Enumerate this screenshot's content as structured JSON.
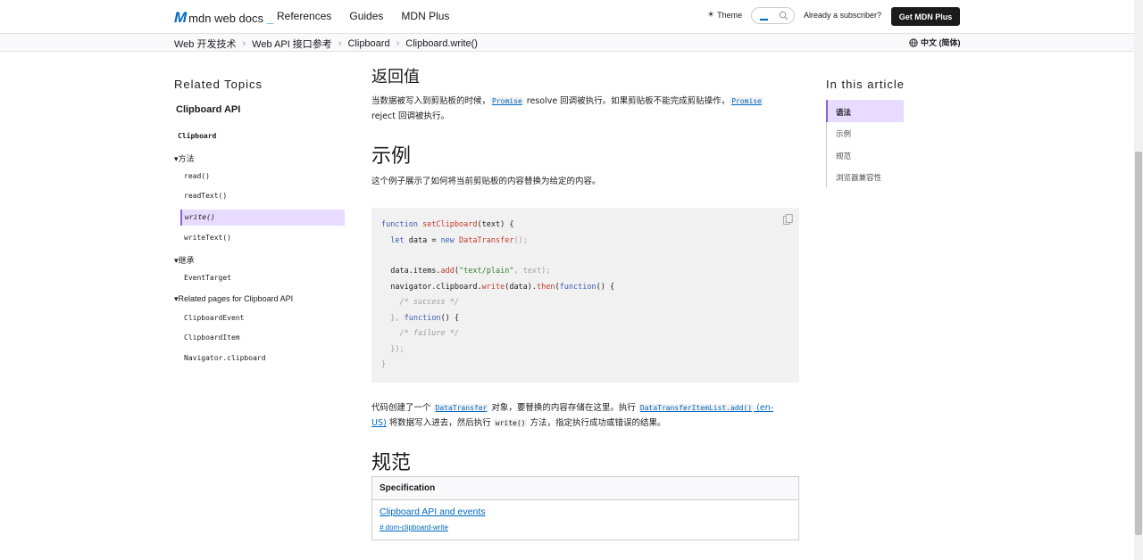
{
  "header": {
    "logo_mark": "M",
    "logo_text": "mdn web docs",
    "logo_underscore": "_",
    "nav": [
      "References",
      "Guides",
      "MDN Plus"
    ],
    "theme_label": "Theme",
    "subscriber_text": "Already a subscriber?",
    "cta_label": "Get MDN Plus"
  },
  "breadcrumb": {
    "items": [
      "Web 开发技术",
      "Web API 接口参考",
      "Clipboard",
      "Clipboard.write()"
    ],
    "language": "中文 (简体)"
  },
  "sidebar": {
    "related_title": "Related Topics",
    "api_title": "Clipboard API",
    "interface": "Clipboard",
    "methods_label": "方法",
    "methods": [
      "read()",
      "readText()",
      "write()",
      "writeText()"
    ],
    "inherit_label": "继承",
    "inherit_items": [
      "EventTarget"
    ],
    "related_label": "Related pages for Clipboard API",
    "related_items": [
      "ClipboardEvent",
      "ClipboardItem",
      "Navigator.clipboard"
    ]
  },
  "content": {
    "return_heading": "返回值",
    "return_p1": "当数据被写入到剪贴板的时候，",
    "promise": "Promise",
    "return_p2": " resolve 回调被执行。如果剪贴板不能完成剪贴操作，",
    "return_p3": "reject 回调被执行。",
    "example_heading": "示例",
    "example_intro": "这个例子展示了如何将当前剪贴板的内容替换为给定的内容。",
    "code": {
      "l1_kw": "function",
      "l1_fn": "setClipboard",
      "l1_rest": "(text) {",
      "l2_kw": "let",
      "l2_mid": " data = ",
      "l2_kw2": "new",
      "l2_fn": "DataTransfer",
      "l2_rest": "();",
      "l4_a": "data.items.",
      "l4_fn": "add",
      "l4_str": "\"text/plain\"",
      "l4_rest": ", text);",
      "l5_a": "navigator.clipboard.",
      "l5_fn": "write",
      "l5_b": "(data).",
      "l5_fn2": "then",
      "l5_kw": "function",
      "l5_rest": "() {",
      "l6_cm": "/* success */",
      "l7_a": "}, ",
      "l7_kw": "function",
      "l7_rest": "() {",
      "l8_cm": "/* failure */",
      "l9": "});",
      "l10": "}"
    },
    "explain_p1": "代码创建了一个 ",
    "explain_code1": "DataTransfer",
    "explain_p2": " 对象，要替换的内容存储在这里。执行 ",
    "explain_code2": "DataTransferItemList.add()",
    "explain_en": " (en-",
    "explain_us": "US)",
    "explain_p3": " 将数据写入进去，然后执行 ",
    "explain_code3": "write()",
    "explain_p4": " 方法，指定执行成功或错误的结果。",
    "spec_heading": "规范",
    "spec_table_header": "Specification",
    "spec_link": "Clipboard API and events",
    "spec_anchor": "# dom-clipboard-write"
  },
  "toc": {
    "title": "In this article",
    "items": [
      "语法",
      "示例",
      "规范",
      "浏览器兼容性"
    ]
  }
}
